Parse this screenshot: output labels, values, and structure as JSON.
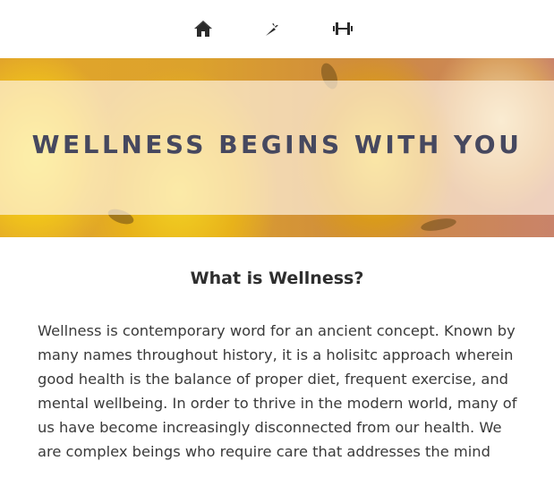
{
  "nav": {
    "items": [
      {
        "icon": "home-icon",
        "label": ""
      },
      {
        "icon": "carrot-icon",
        "label": ""
      },
      {
        "icon": "dumbbell-icon",
        "label": ""
      }
    ],
    "icon_color": "#2b2b2b"
  },
  "hero": {
    "title": "WELLNESS BEGINS WITH YOU",
    "title_color": "#46485f"
  },
  "section": {
    "heading": "What is Wellness?",
    "body": "Wellness is contemporary word for an ancient concept. Known by many names throughout history, it is a holisitc approach wherein good health is the balance of proper diet, frequent exercise, and mental wellbeing. In order to thrive in the modern world, many of us have become increasingly disconnected from our health. We are complex beings who require care that addresses the mind"
  }
}
